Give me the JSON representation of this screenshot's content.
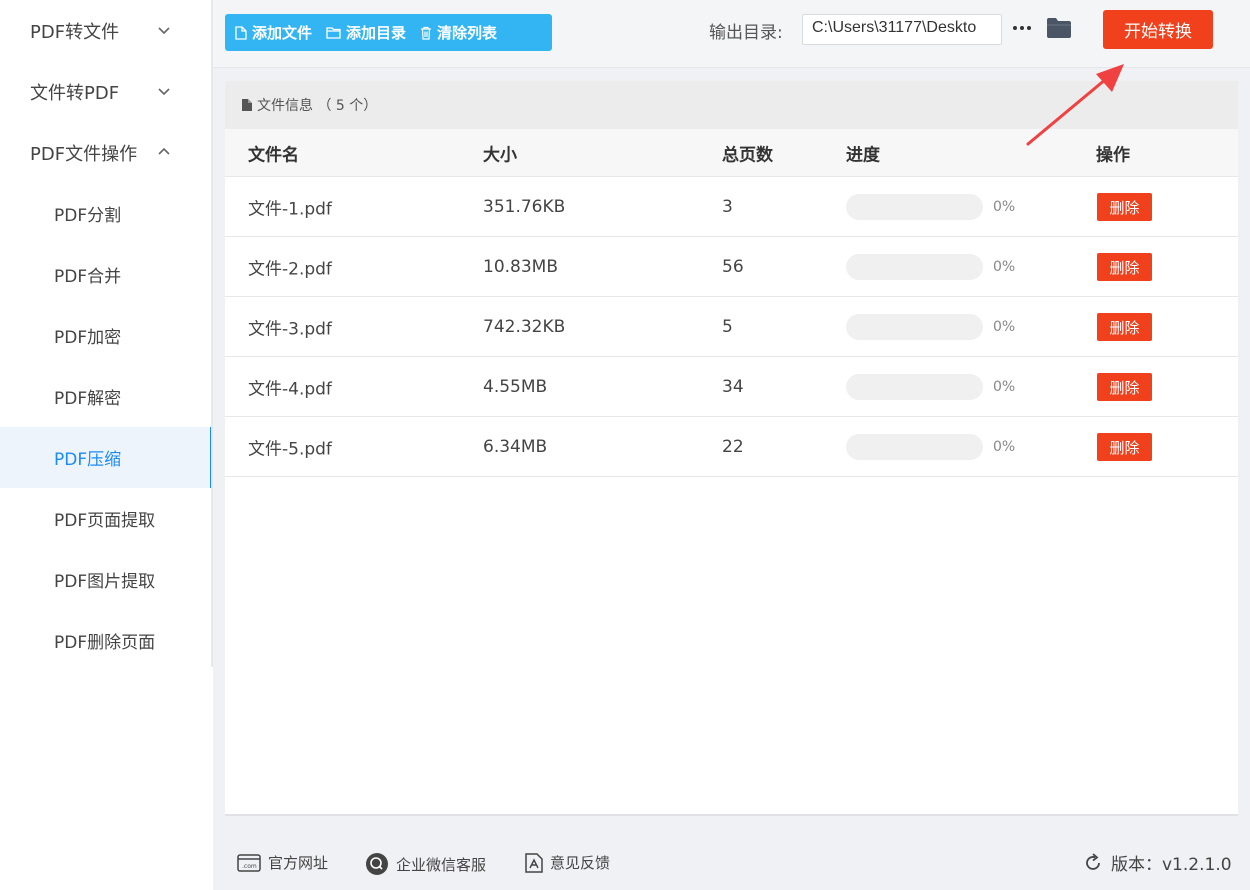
{
  "sidebar": {
    "groups": [
      {
        "label": "PDF转文件",
        "expanded": false
      },
      {
        "label": "文件转PDF",
        "expanded": false
      },
      {
        "label": "PDF文件操作",
        "expanded": true
      }
    ],
    "items": [
      {
        "label": "PDF分割"
      },
      {
        "label": "PDF合并"
      },
      {
        "label": "PDF加密"
      },
      {
        "label": "PDF解密"
      },
      {
        "label": "PDF压缩"
      },
      {
        "label": "PDF页面提取"
      },
      {
        "label": "PDF图片提取"
      },
      {
        "label": "PDF删除页面"
      }
    ],
    "active_item": "PDF压缩"
  },
  "toolbar": {
    "add_file_label": "添加文件",
    "add_dir_label": "添加目录",
    "clear_list_label": "清除列表",
    "output_label": "输出目录:",
    "output_path": "C:\\Users\\31177\\Deskto",
    "start_label": "开始转换"
  },
  "panel": {
    "title": "文件信息 （ 5 个）",
    "columns": [
      "文件名",
      "大小",
      "总页数",
      "进度",
      "操作"
    ],
    "rows": [
      {
        "name": "文件-1.pdf",
        "size": "351.76KB",
        "pages": "3",
        "progress": 0,
        "progress_text": "0%",
        "action": "删除"
      },
      {
        "name": "文件-2.pdf",
        "size": "10.83MB",
        "pages": "56",
        "progress": 0,
        "progress_text": "0%",
        "action": "删除"
      },
      {
        "name": "文件-3.pdf",
        "size": "742.32KB",
        "pages": "5",
        "progress": 0,
        "progress_text": "0%",
        "action": "删除"
      },
      {
        "name": "文件-4.pdf",
        "size": "4.55MB",
        "pages": "34",
        "progress": 0,
        "progress_text": "0%",
        "action": "删除"
      },
      {
        "name": "文件-5.pdf",
        "size": "6.34MB",
        "pages": "22",
        "progress": 0,
        "progress_text": "0%",
        "action": "删除"
      }
    ]
  },
  "footer": {
    "website_label": "官方网址",
    "wechat_label": "企业微信客服",
    "feedback_label": "意见反馈",
    "version_label": "版本：v1.2.1.0"
  },
  "colors": {
    "accent_blue": "#33b5f3",
    "active_blue": "#1b8cf0",
    "danger_red": "#f0401c",
    "arrow_red": "#f04040"
  }
}
